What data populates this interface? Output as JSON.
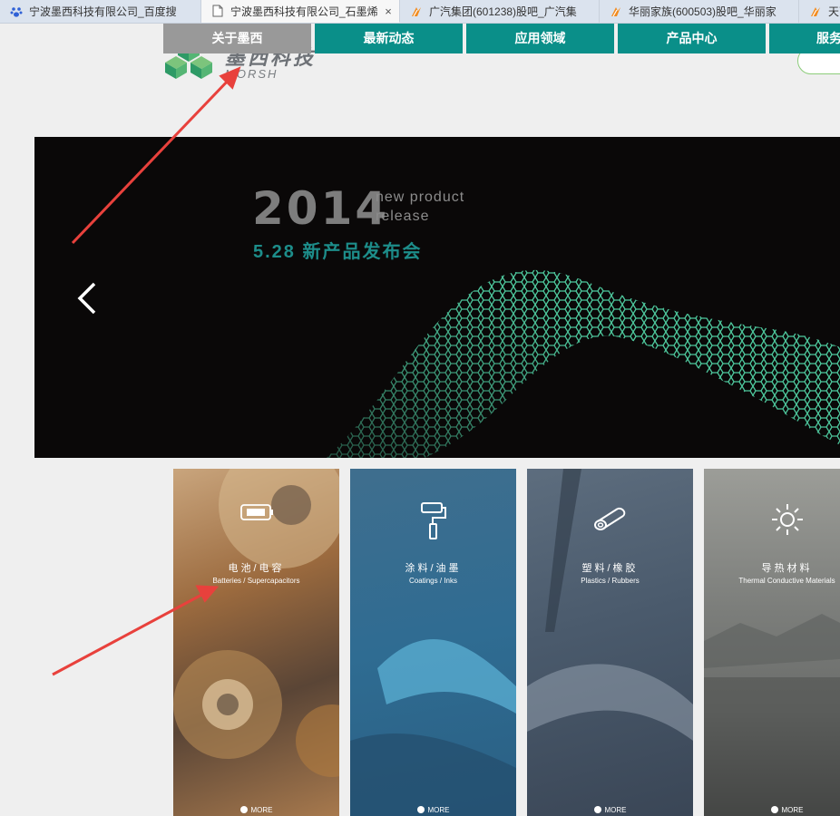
{
  "browser": {
    "tabs": [
      {
        "title": "宁波墨西科技有限公司_百度搜",
        "icon": "baidu-paw-icon",
        "active": false
      },
      {
        "title": "宁波墨西科技有限公司_石墨烯",
        "icon": "page-icon",
        "active": true,
        "close": "×"
      },
      {
        "title": "广汽集团(601238)股吧_广汽集",
        "icon": "stock-bar-icon",
        "active": false
      },
      {
        "title": "华丽家族(600503)股吧_华丽家",
        "icon": "stock-bar-icon",
        "active": false
      },
      {
        "title": "天下",
        "icon": "stock-bar-icon",
        "active": false
      }
    ]
  },
  "header": {
    "logo_cn": "墨西科技",
    "logo_en": "MORSH"
  },
  "nav": {
    "items": [
      {
        "label": "关于墨西",
        "color": "#999999"
      },
      {
        "label": "最新动态",
        "color": "#0a8f89"
      },
      {
        "label": "应用领域",
        "color": "#0a8f89"
      },
      {
        "label": "产品中心",
        "color": "#0a8f89"
      },
      {
        "label": "服务",
        "color": "#0a8f89"
      }
    ]
  },
  "banner": {
    "year": "2014",
    "tag_line1": "new product",
    "tag_line2": "release",
    "date_title": "5.28 新产品发布会",
    "prev_icon": "chevron-left-icon"
  },
  "cards": [
    {
      "cn": "电池/电容",
      "en": "Batteries / Supercapacitors",
      "more": "MORE",
      "icon": "battery-icon"
    },
    {
      "cn": "涂料/油墨",
      "en": "Coatings / Inks",
      "more": "MORE",
      "icon": "paint-roller-icon"
    },
    {
      "cn": "塑料/橡胶",
      "en": "Plastics / Rubbers",
      "more": "MORE",
      "icon": "pipe-icon"
    },
    {
      "cn": "导热材料",
      "en": "Thermal Conductive Materials",
      "more": "MORE",
      "icon": "sun-icon"
    }
  ],
  "colors": {
    "brand_teal": "#0a8f89",
    "nav_active_gray": "#999999",
    "annotation_red": "#e8413c"
  }
}
